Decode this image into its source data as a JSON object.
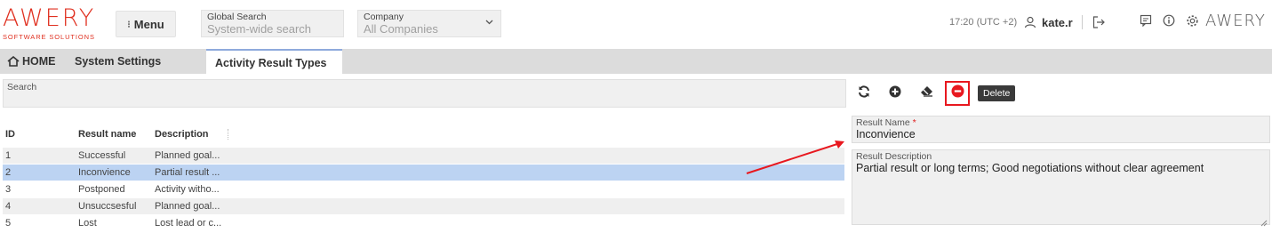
{
  "header": {
    "logo_word": "AWERY",
    "logo_sub": "SOFTWARE SOLUTIONS",
    "menu_label": "Menu",
    "global_search": {
      "label": "Global Search",
      "placeholder": "System-wide search"
    },
    "company": {
      "label": "Company",
      "value": "All Companies"
    },
    "time": "17:20 (UTC +2)",
    "user": "kate.r",
    "brand_small": "AWERY",
    "icons": [
      "menu-dots-icon",
      "chevron-down-icon",
      "user-icon",
      "logout-icon",
      "chat-icon",
      "info-icon",
      "settings-icon"
    ]
  },
  "tabs": [
    {
      "label": "HOME",
      "icon": "home-icon"
    },
    {
      "label": "System Settings"
    },
    {
      "label": "Activity Result Types",
      "active": true
    }
  ],
  "search": {
    "label": "Search"
  },
  "table": {
    "columns": [
      "ID",
      "Result name",
      "Description"
    ],
    "rows": [
      {
        "id": "1",
        "name": "Successful",
        "desc": "Planned goal..."
      },
      {
        "id": "2",
        "name": "Inconvience",
        "desc": "Partial result ...",
        "selected": true
      },
      {
        "id": "3",
        "name": "Postponed",
        "desc": "Activity witho..."
      },
      {
        "id": "4",
        "name": "Unsuccsesful",
        "desc": "Planned goal..."
      },
      {
        "id": "5",
        "name": "Lost",
        "desc": "Lost lead or c..."
      }
    ]
  },
  "toolbar": {
    "buttons": [
      "refresh-icon",
      "add-icon",
      "eraser-icon",
      "delete-icon"
    ],
    "tooltip": "Delete"
  },
  "form": {
    "result_name": {
      "label": "Result Name",
      "required": "*",
      "value": "Inconvience"
    },
    "result_description": {
      "label": "Result Description",
      "value": "Partial result or long terms; Good negotiations without clear agreement"
    }
  },
  "colors": {
    "brand": "#e03020",
    "selected_row": "#bcd3f2",
    "highlight": "#e8181f",
    "tab_accent": "#8faadc"
  }
}
